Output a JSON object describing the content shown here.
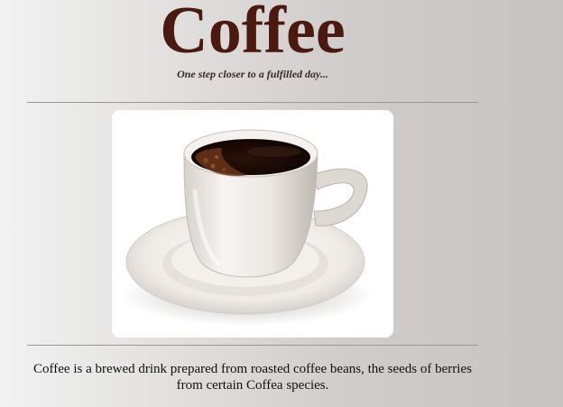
{
  "header": {
    "title": "Coffee",
    "tagline": "One step closer to a fulfilled day..."
  },
  "hero_image": {
    "subject": "coffee-cup-icon"
  },
  "body": {
    "description": "Coffee is a brewed drink prepared from roasted coffee beans, the seeds of berries from certain Coffea species."
  },
  "colors": {
    "title": "#4a1a0f",
    "background_light": "#f2f2f2",
    "background_dark": "#c7c3c2",
    "rule": "#9c9794"
  }
}
